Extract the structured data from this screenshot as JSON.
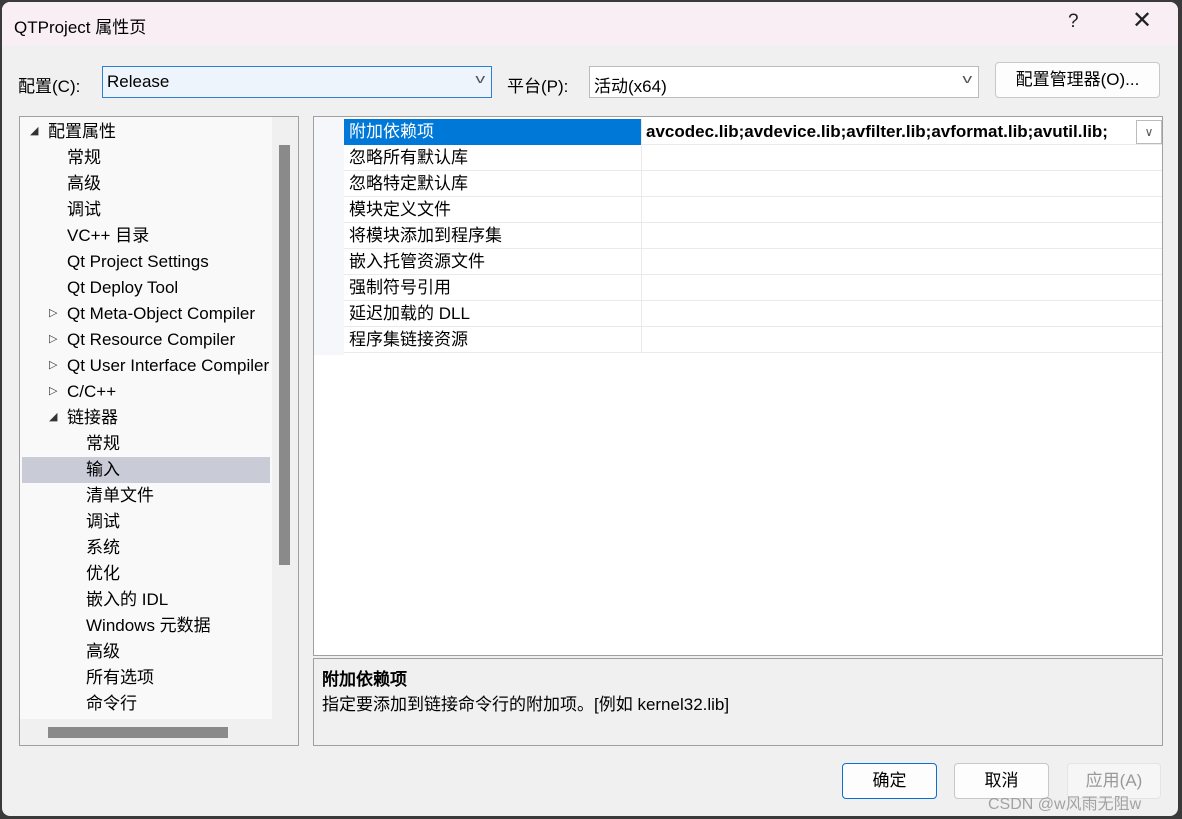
{
  "window": {
    "title": "QTProject 属性页",
    "help": "?",
    "close": "✕"
  },
  "config": {
    "label": "配置(C):",
    "value": "Release",
    "platform_label": "平台(P):",
    "platform_value": "活动(x64)",
    "manager_button": "配置管理器(O)..."
  },
  "tree": {
    "items": [
      {
        "label": "配置属性",
        "level": 0,
        "expander": "expanded"
      },
      {
        "label": "常规",
        "level": 1
      },
      {
        "label": "高级",
        "level": 1
      },
      {
        "label": "调试",
        "level": 1
      },
      {
        "label": "VC++ 目录",
        "level": 1
      },
      {
        "label": "Qt Project Settings",
        "level": 1
      },
      {
        "label": "Qt Deploy Tool",
        "level": 1
      },
      {
        "label": "Qt Meta-Object Compiler",
        "level": 1,
        "expander": "collapsed"
      },
      {
        "label": "Qt Resource Compiler",
        "level": 1,
        "expander": "collapsed"
      },
      {
        "label": "Qt User Interface Compiler",
        "level": 1,
        "expander": "collapsed"
      },
      {
        "label": "C/C++",
        "level": 1,
        "expander": "collapsed"
      },
      {
        "label": "链接器",
        "level": 1,
        "expander": "expanded"
      },
      {
        "label": "常规",
        "level": 2
      },
      {
        "label": "输入",
        "level": 2,
        "selected": true
      },
      {
        "label": "清单文件",
        "level": 2
      },
      {
        "label": "调试",
        "level": 2
      },
      {
        "label": "系统",
        "level": 2
      },
      {
        "label": "优化",
        "level": 2
      },
      {
        "label": "嵌入的 IDL",
        "level": 2
      },
      {
        "label": "Windows 元数据",
        "level": 2
      },
      {
        "label": "高级",
        "level": 2
      },
      {
        "label": "所有选项",
        "level": 2
      },
      {
        "label": "命令行",
        "level": 2
      }
    ]
  },
  "grid": {
    "rows": [
      {
        "name": "附加依赖项",
        "value": "avcodec.lib;avdevice.lib;avfilter.lib;avformat.lib;avutil.lib;",
        "selected": true
      },
      {
        "name": "忽略所有默认库",
        "value": ""
      },
      {
        "name": "忽略特定默认库",
        "value": ""
      },
      {
        "name": "模块定义文件",
        "value": ""
      },
      {
        "name": "将模块添加到程序集",
        "value": ""
      },
      {
        "name": "嵌入托管资源文件",
        "value": ""
      },
      {
        "name": "强制符号引用",
        "value": ""
      },
      {
        "name": "延迟加载的 DLL",
        "value": ""
      },
      {
        "name": "程序集链接资源",
        "value": ""
      }
    ]
  },
  "description": {
    "title": "附加依赖项",
    "text": "指定要添加到链接命令行的附加项。[例如 kernel32.lib]"
  },
  "buttons": {
    "ok": "确定",
    "cancel": "取消",
    "apply": "应用(A)"
  },
  "watermark": "CSDN @w风雨无阻w",
  "colors": {
    "selection": "#0078d7",
    "tree_selection": "#c9cbd6",
    "titlebar": "#f9eef3"
  }
}
